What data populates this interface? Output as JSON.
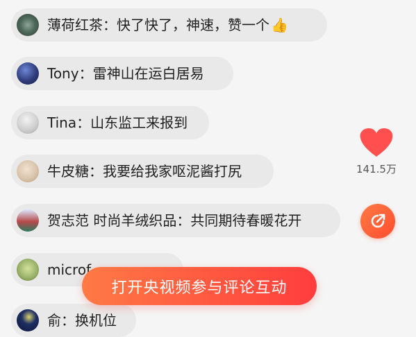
{
  "comments": [
    {
      "text": "薄荷红茶：快了快了，神速，赞一个",
      "emoji": "👍",
      "avatar_color": "#4f6b5c"
    },
    {
      "text": "Tony：雷神山在运白居易",
      "avatar_color": "#2f3c7a"
    },
    {
      "text": "Tina：山东监工来报到",
      "avatar_color": "#cfcfcf"
    },
    {
      "text": "牛皮糖：我要给我家呕泥酱打尻",
      "avatar_color": "#d9c4ac"
    },
    {
      "text": "贺志范 时尚羊绒织品：共同期待春暖花开",
      "avatar_color": "#b74a4a"
    },
    {
      "text": "microf",
      "avatar_color": "#9cb36b"
    },
    {
      "text": "俞：换机位",
      "avatar_color": "#1f2e63"
    }
  ],
  "like": {
    "count": "141.5万",
    "color": "#ff4f4f"
  },
  "share": {
    "color": "#ff5a36"
  },
  "cta": {
    "label": "打开央视频参与评论互动"
  }
}
